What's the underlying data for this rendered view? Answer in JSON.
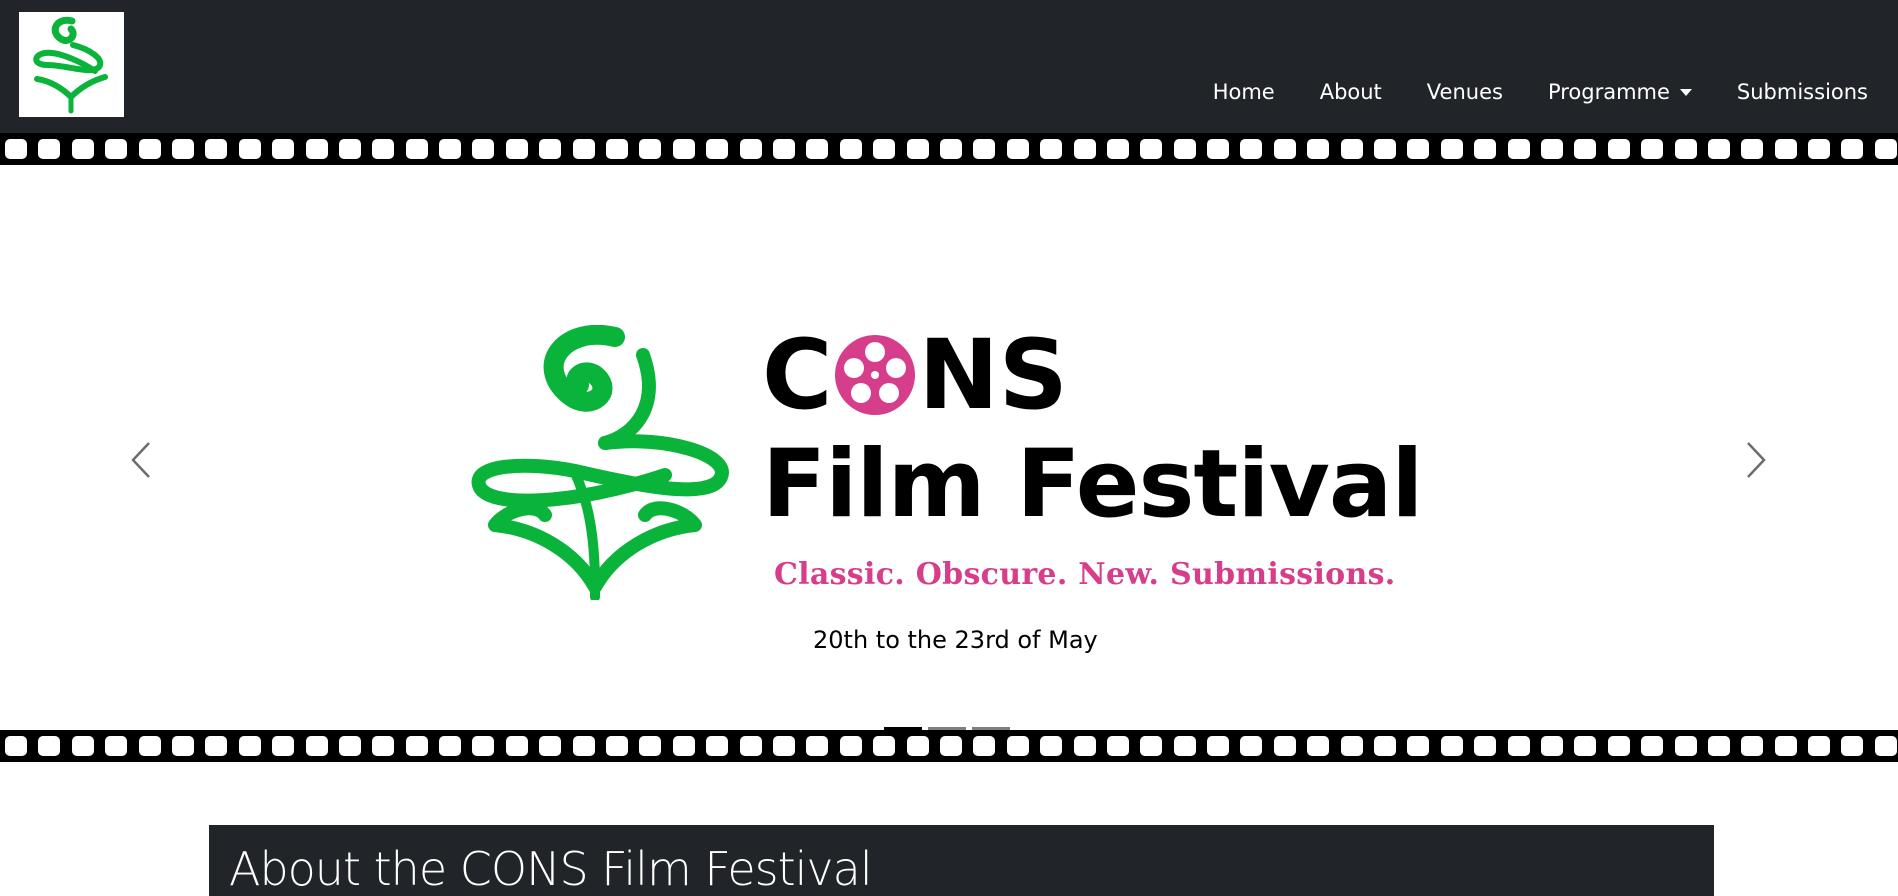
{
  "navbar": {
    "brand_icon": "festival-logo-icon",
    "links": [
      {
        "label": "Home"
      },
      {
        "label": "About"
      },
      {
        "label": "Venues"
      },
      {
        "label": "Programme",
        "dropdown": true
      },
      {
        "label": "Submissions"
      }
    ]
  },
  "hero": {
    "title_line1_prefix": "C",
    "title_line1_suffix": "NS",
    "title_line2": "Film Festival",
    "tagline": "Classic. Obscure. New. Submissions.",
    "dates": "20th to the 23rd of May",
    "prev_icon": "chevron-left-icon",
    "next_icon": "chevron-right-icon",
    "slide_count": 3,
    "active_slide": 1
  },
  "about": {
    "heading": "About the CONS Film Festival"
  },
  "colors": {
    "navbar_bg": "#212529",
    "logo_green": "#0ab33a",
    "accent_pink": "#d63d8a",
    "filmstrip": "#000000"
  }
}
